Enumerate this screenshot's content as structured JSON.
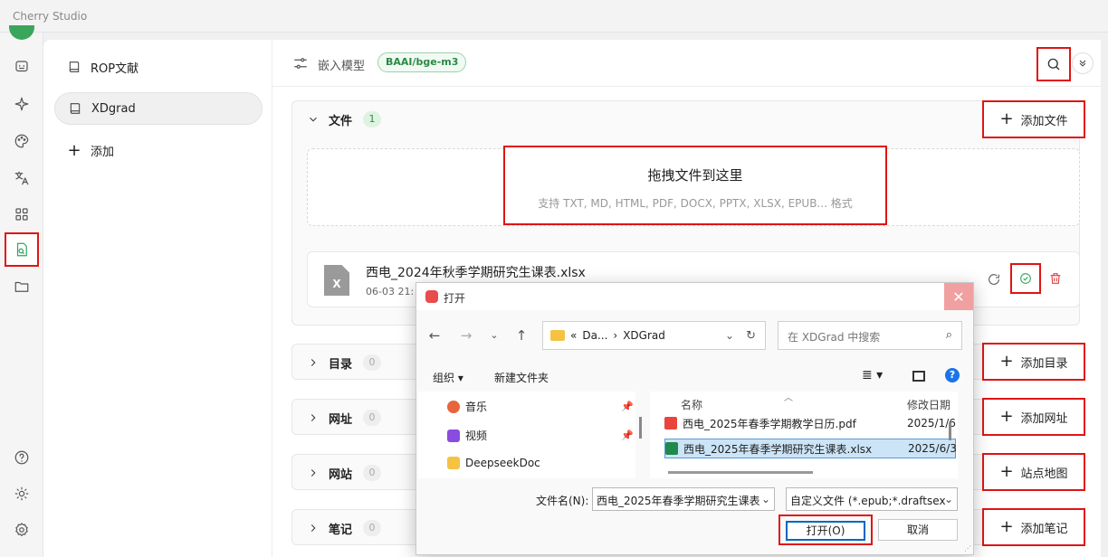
{
  "app": {
    "title": "Cherry Studio"
  },
  "nav": {
    "icons": [
      "chat-icon",
      "sparkle-icon",
      "palette-icon",
      "translate-icon",
      "apps-icon",
      "knowledge-icon",
      "folder-icon",
      "help-icon",
      "brightness-icon",
      "settings-icon"
    ],
    "active": "knowledge-icon",
    "accent": "#2ea65a"
  },
  "knowledge_bases": {
    "items": [
      {
        "label": "ROP文献",
        "selected": false
      },
      {
        "label": "XDgrad",
        "selected": true
      }
    ],
    "add_label": "添加"
  },
  "header": {
    "embedding_label": "嵌入模型",
    "model_tag": "BAAI/bge-m3"
  },
  "files_section": {
    "title": "文件",
    "count": "1",
    "add_button": "添加文件",
    "dropzone": {
      "title": "拖拽文件到这里",
      "subtitle": "支持 TXT, MD, HTML, PDF, DOCX, PPTX, XLSX, EPUB... 格式"
    },
    "file": {
      "icon_letter": "X",
      "name": "西电_2024年秋季学期研究生课表.xlsx",
      "date": "06-03 21:"
    }
  },
  "sections": [
    {
      "title": "目录",
      "count": "0",
      "button": "添加目录"
    },
    {
      "title": "网址",
      "count": "0",
      "button": "添加网址"
    },
    {
      "title": "网站",
      "count": "0",
      "button": "站点地图"
    },
    {
      "title": "笔记",
      "count": "0",
      "button": "添加笔记"
    }
  ],
  "dialog": {
    "title": "打开",
    "close": "✕",
    "address": {
      "prefix": "«",
      "part1": "Da...",
      "sep": "›",
      "part2": "XDGrad"
    },
    "search_placeholder": "在 XDGrad 中搜索",
    "organize": "组织 ▾",
    "new_folder": "新建文件夹",
    "help": "?",
    "left_items": [
      {
        "label": "音乐",
        "color": "#e8643c"
      },
      {
        "label": "视频",
        "color": "#8a4be0"
      },
      {
        "label": "DeepseekDoc",
        "color": "#f5c242"
      }
    ],
    "columns": {
      "name": "名称",
      "modified": "修改日期"
    },
    "files": [
      {
        "name": "西电_2025年春季学期教学日历.pdf",
        "date": "2025/1/6",
        "type": "pdf",
        "color": "#e8453c",
        "selected": false
      },
      {
        "name": "西电_2025年春季学期研究生课表.xlsx",
        "date": "2025/6/3",
        "type": "xlsx",
        "color": "#1f8a4c",
        "selected": true
      }
    ],
    "filename_label": "文件名(N):",
    "filename_value": "西电_2025年春季学期研究生课表",
    "filter_value": "自定义文件 (*.epub;*.draftsex",
    "open_button": "打开(O)",
    "cancel_button": "取消"
  }
}
